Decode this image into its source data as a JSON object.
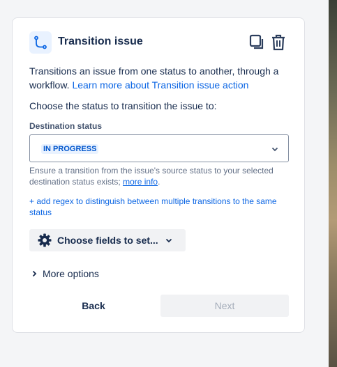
{
  "panel": {
    "title": "Transition issue",
    "description": "Transitions an issue from one status to another, through a workflow. ",
    "learn_more_link": "Learn more about Transition issue action",
    "choose_prompt": "Choose the status to transition the issue to:",
    "destination": {
      "label": "Destination status",
      "value": "IN PROGRESS"
    },
    "helper_text": "Ensure a transition from the issue's source status to your selected destination status exists; ",
    "helper_link": "more info",
    "helper_end": ".",
    "regex_link": "+ add regex to distinguish between multiple transitions to the same status",
    "choose_fields_label": "Choose fields to set...",
    "more_options_label": "More options",
    "back_label": "Back",
    "next_label": "Next"
  },
  "icons": {
    "logo": "transition-icon",
    "copy": "copy-icon",
    "delete": "trash-icon",
    "gear": "gear-icon"
  },
  "colors": {
    "link": "#0c66e4",
    "lozenge_bg": "#e9f2ff",
    "lozenge_text": "#0055cc",
    "text": "#172b4d"
  }
}
